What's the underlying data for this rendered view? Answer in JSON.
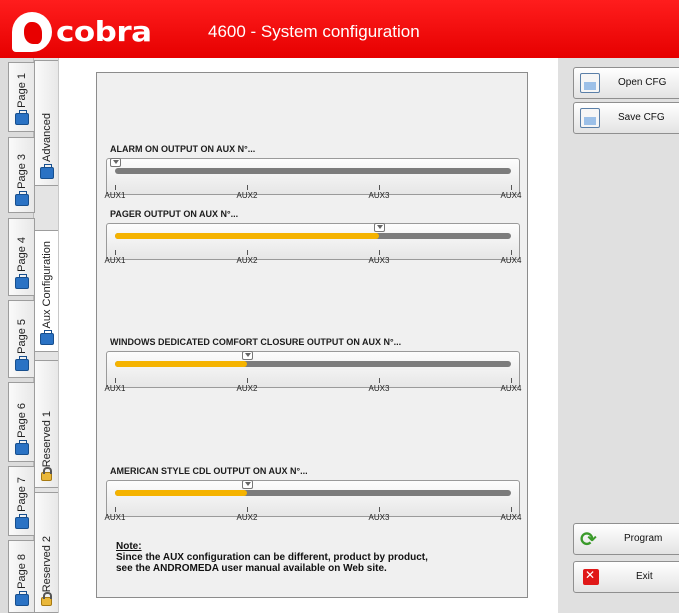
{
  "header": {
    "logo_text": "cobra",
    "title": "4600 - System configuration"
  },
  "tabs_outer": [
    {
      "label": "Page 1",
      "icon": "briefcase-icon"
    },
    {
      "label": "Page 3",
      "icon": "briefcase-icon"
    },
    {
      "label": "Page 4",
      "icon": "briefcase-icon"
    },
    {
      "label": "Page 5",
      "icon": "briefcase-icon"
    },
    {
      "label": "Page 6",
      "icon": "briefcase-icon"
    },
    {
      "label": "Page 7",
      "icon": "briefcase-icon"
    },
    {
      "label": "Page 8",
      "icon": "briefcase-icon"
    }
  ],
  "tabs_inner": [
    {
      "label": "Advanced",
      "icon": "briefcase-icon"
    },
    {
      "label": "Aux Configuration",
      "icon": "briefcase-icon",
      "selected": true
    },
    {
      "label": "Reserved 1",
      "icon": "lock-icon"
    },
    {
      "label": "Reserved 2",
      "icon": "lock-icon"
    }
  ],
  "sliders": [
    {
      "label": "ALARM ON OUTPUT ON AUX N°...",
      "value": "AUX1",
      "fraction": 0.0
    },
    {
      "label": "PAGER OUTPUT ON AUX N°...",
      "value": "AUX3",
      "fraction": 0.6667
    },
    {
      "label": "WINDOWS DEDICATED COMFORT CLOSURE OUTPUT ON AUX N°...",
      "value": "AUX2",
      "fraction": 0.3333
    },
    {
      "label": "AMERICAN STYLE CDL OUTPUT ON AUX N°...",
      "value": "AUX2",
      "fraction": 0.3333
    }
  ],
  "tick_labels": [
    "AUX1",
    "AUX2",
    "AUX3",
    "AUX4"
  ],
  "note": {
    "heading": "Note:",
    "line1": "Since the AUX configuration can be different, product by product,",
    "line2": "see the ANDROMEDA user manual available on Web site."
  },
  "buttons": {
    "open_cfg": "Open CFG",
    "save_cfg": "Save CFG",
    "program": "Program",
    "exit": "Exit"
  },
  "colors": {
    "brand_red": "#e60000",
    "slider_fill": "#f5b300"
  }
}
